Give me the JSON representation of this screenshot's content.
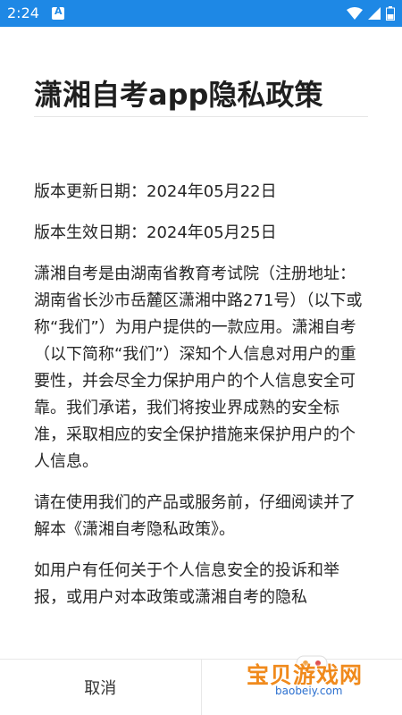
{
  "status_bar": {
    "time": "2:24"
  },
  "page": {
    "title": "潇湘自考app隐私政策",
    "paragraphs": [
      "版本更新日期：2024年05月22日",
      "版本生效日期：2024年05月25日",
      "潇湘自考是由湖南省教育考试院（注册地址：湖南省长沙市岳麓区潇湘中路271号）（以下或称“我们”）为用户提供的一款应用。潇湘自考（以下简称“我们”）深知个人信息对用户的重要性，并会尽全力保护用户的个人信息安全可靠。我们承诺，我们将按业界成熟的安全标准，采取相应的安全保护措施来保护用户的个人信息。",
      "请在使用我们的产品或服务前，仔细阅读并了解本《潇湘自考隐私政策》。",
      "如用户有任何关于个人信息安全的投诉和举报，或用户对本政策或潇湘自考的隐私"
    ]
  },
  "footer": {
    "cancel_label": "取消",
    "agree_label": ""
  },
  "watermark": {
    "text": "宝贝游戏网",
    "url": "baobeiy.com"
  },
  "colors": {
    "status_bar": "#1e88e5",
    "watermark": "#f08a1c"
  }
}
